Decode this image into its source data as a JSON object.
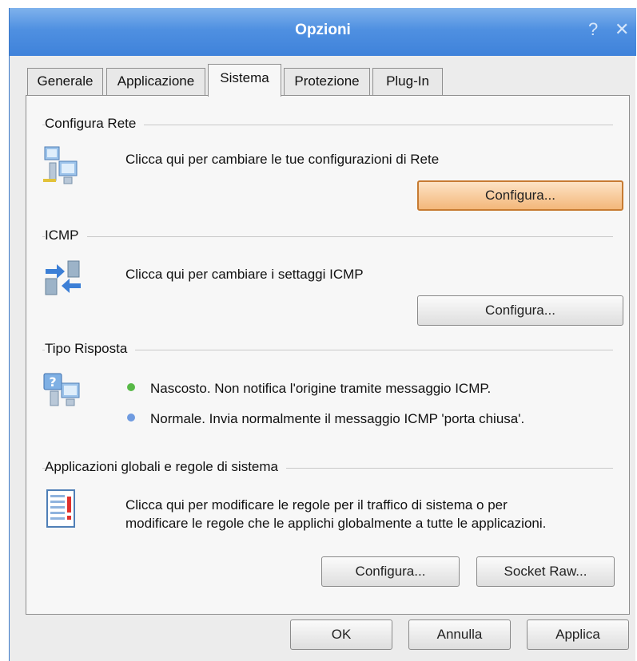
{
  "window": {
    "title": "Opzioni",
    "help_glyph": "?",
    "close_glyph": "✕"
  },
  "tabs": [
    {
      "label": "Generale"
    },
    {
      "label": "Applicazione"
    },
    {
      "label": "Sistema"
    },
    {
      "label": "Protezione"
    },
    {
      "label": "Plug-In"
    }
  ],
  "active_tab": "Sistema",
  "sections": {
    "rete": {
      "heading": "Configura Rete",
      "icon": "network-computers-icon",
      "text": "Clicca qui per cambiare le tue configurazioni di Rete",
      "button": "Configura..."
    },
    "icmp": {
      "heading": "ICMP",
      "icon": "icmp-exchange-icon",
      "text": "Clicca qui per cambiare i settaggi ICMP",
      "button": "Configura..."
    },
    "risposta": {
      "heading": "Tipo Risposta",
      "icon": "response-help-icon",
      "options": [
        {
          "text": "Nascosto. Non notifica l'origine tramite messaggio ICMP.",
          "color": "#58b947"
        },
        {
          "text": "Normale. Invia normalmente il messaggio ICMP 'porta chiusa'.",
          "color": "#6f9be0"
        }
      ]
    },
    "globali": {
      "heading": "Applicazioni globali e regole di sistema",
      "icon": "rules-document-icon",
      "text_line1": "Clicca qui per modificare le regole per il traffico di sistema o per",
      "text_line2": "modificare le regole che le applichi globalmente a tutte le applicazioni.",
      "button_configura": "Configura...",
      "button_socket": "Socket Raw..."
    }
  },
  "footer": {
    "ok": "OK",
    "annulla": "Annulla",
    "applica": "Applica"
  },
  "colors": {
    "titlebar": "#4f90e1",
    "focused_button": "#f3b77a"
  }
}
